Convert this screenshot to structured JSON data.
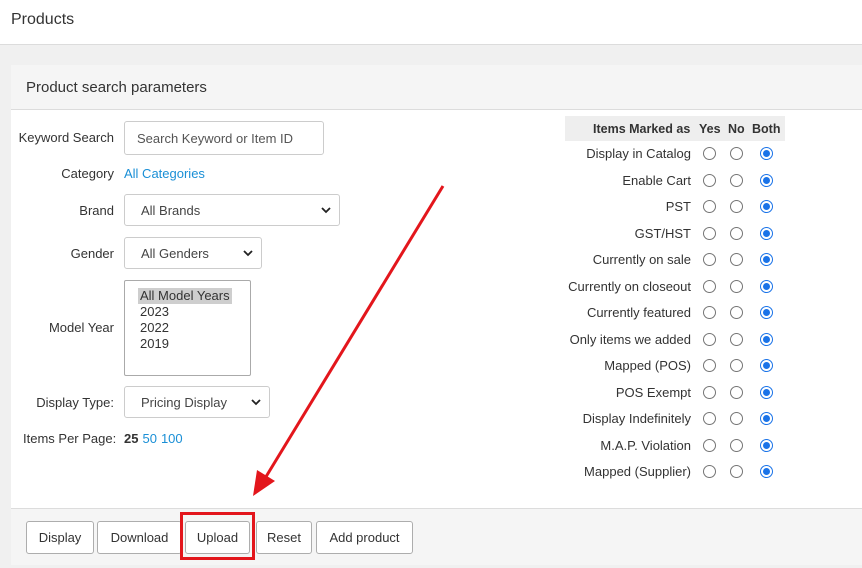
{
  "page": {
    "title": "Products"
  },
  "panel": {
    "title": "Product search parameters"
  },
  "search": {
    "keyword_label": "Keyword Search",
    "keyword_placeholder": "Search Keyword or Item ID",
    "category_label": "Category",
    "category_value": "All Categories",
    "brand_label": "Brand",
    "brand_value": "All Brands",
    "gender_label": "Gender",
    "gender_value": "All Genders",
    "model_year_label": "Model Year",
    "model_year_options": [
      {
        "label": "All Model Years",
        "selected": true
      },
      {
        "label": "2023",
        "selected": false
      },
      {
        "label": "2022",
        "selected": false
      },
      {
        "label": "2019",
        "selected": false
      }
    ],
    "display_type_label": "Display Type:",
    "display_type_value": "Pricing Display",
    "items_per_page_label": "Items Per Page:",
    "items_per_page_current": "25",
    "items_per_page_options": [
      "50",
      "100"
    ]
  },
  "attributes": {
    "header": {
      "label": "Items Marked as",
      "yes": "Yes",
      "no": "No",
      "both": "Both"
    },
    "rows": [
      {
        "label": "Display in Catalog",
        "value": "Both"
      },
      {
        "label": "Enable Cart",
        "value": "Both"
      },
      {
        "label": "PST",
        "value": "Both"
      },
      {
        "label": "GST/HST",
        "value": "Both"
      },
      {
        "label": "Currently on sale",
        "value": "Both"
      },
      {
        "label": "Currently on closeout",
        "value": "Both"
      },
      {
        "label": "Currently featured",
        "value": "Both"
      },
      {
        "label": "Only items we added",
        "value": "Both"
      },
      {
        "label": "Mapped (POS)",
        "value": "Both"
      },
      {
        "label": "POS Exempt",
        "value": "Both"
      },
      {
        "label": "Display Indefinitely",
        "value": "Both"
      },
      {
        "label": "M.A.P. Violation",
        "value": "Both"
      },
      {
        "label": "Mapped (Supplier)",
        "value": "Both"
      }
    ]
  },
  "actions": {
    "display": "Display",
    "download": "Download",
    "upload": "Upload",
    "reset": "Reset",
    "add_product": "Add product"
  },
  "colors": {
    "link": "#1a8fd6",
    "radio_checked": "#1a73e8",
    "annotation": "#e3161c"
  }
}
